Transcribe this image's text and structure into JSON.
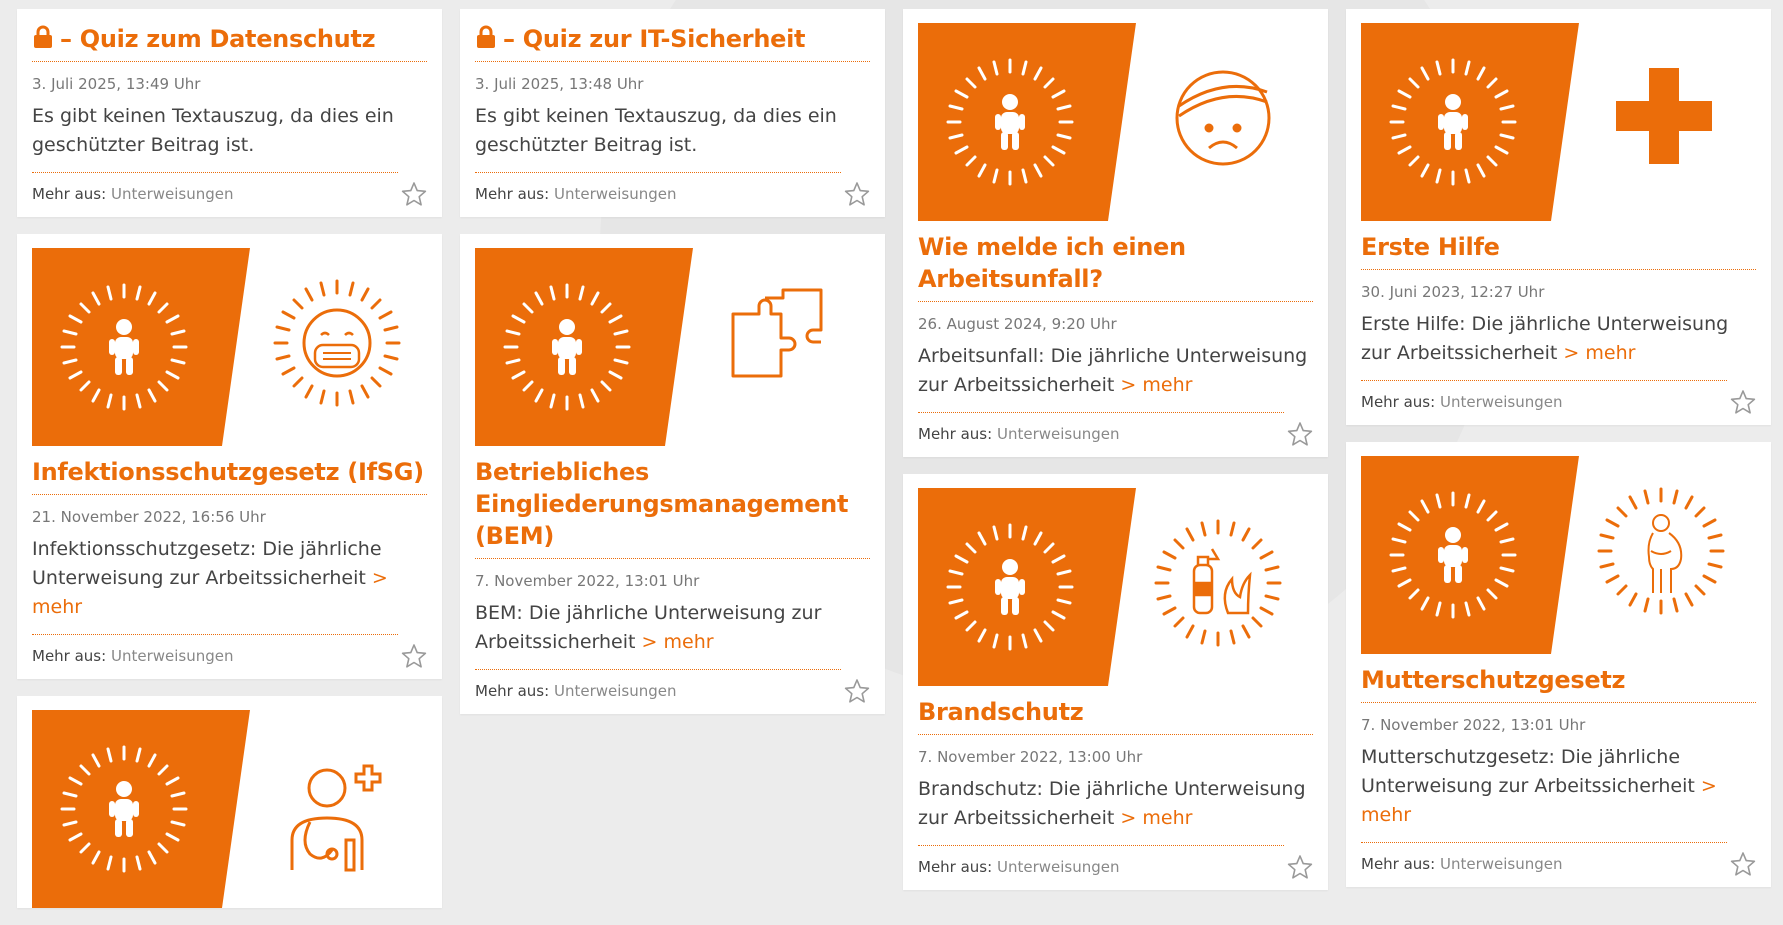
{
  "colors": {
    "accent": "#eb6d0a",
    "date": "#777777",
    "text": "#444444",
    "muted": "#888888"
  },
  "icons": [
    "lock-icon",
    "star-icon",
    "child-sunburst-icon",
    "face-mask-icon",
    "puzzle-icon",
    "bandaged-face-icon",
    "cross-icon",
    "fire-extinguisher-icon",
    "pregnant-woman-icon",
    "doctor-icon"
  ],
  "more_label": "> mehr",
  "footer_prefix": "Mehr aus:",
  "footer_category": "Unterweisungen",
  "cards": [
    {
      "title": "– Quiz zum Datenschutz",
      "date": "3. Juli 2025, 13:49 Uhr",
      "excerpt": "Es gibt keinen Textauszug, da dies ein geschützter Beitrag ist."
    },
    {
      "title": "Infektionsschutzgesetz (IfSG)",
      "date": "21. November 2022, 16:56 Uhr",
      "excerpt": "Infektionsschutzgesetz: Die jährliche Unterweisung zur Arbeitssicherheit"
    },
    {
      "title": "– Quiz zur IT-Sicherheit",
      "date": "3. Juli 2025, 13:48 Uhr",
      "excerpt": "Es gibt keinen Textauszug, da dies ein geschützter Beitrag ist."
    },
    {
      "title": "Betriebliches Eingliederungsmanagement (BEM)",
      "date": "7. November 2022, 13:01 Uhr",
      "excerpt": "BEM: Die jährliche Unterweisung zur Arbeitssicherheit"
    },
    {
      "title": "Wie melde ich einen Arbeitsunfall?",
      "date": "26. August 2024, 9:20 Uhr",
      "excerpt": "Arbeitsunfall: Die jährliche Unterweisung zur Arbeitssicherheit"
    },
    {
      "title": "Brandschutz",
      "date": "7. November 2022, 13:00 Uhr",
      "excerpt": "Brandschutz: Die jährliche Unterweisung zur Arbeitssicherheit"
    },
    {
      "title": "Erste Hilfe",
      "date": "30. Juni 2023, 12:27 Uhr",
      "excerpt": "Erste Hilfe: Die jährliche Unterweisung zur Arbeitssicherheit"
    },
    {
      "title": "Mutterschutzgesetz",
      "date": "7. November 2022, 13:01 Uhr",
      "excerpt": "Mutterschutzgesetz: Die jährliche Unterweisung zur Arbeitssicherheit"
    }
  ]
}
